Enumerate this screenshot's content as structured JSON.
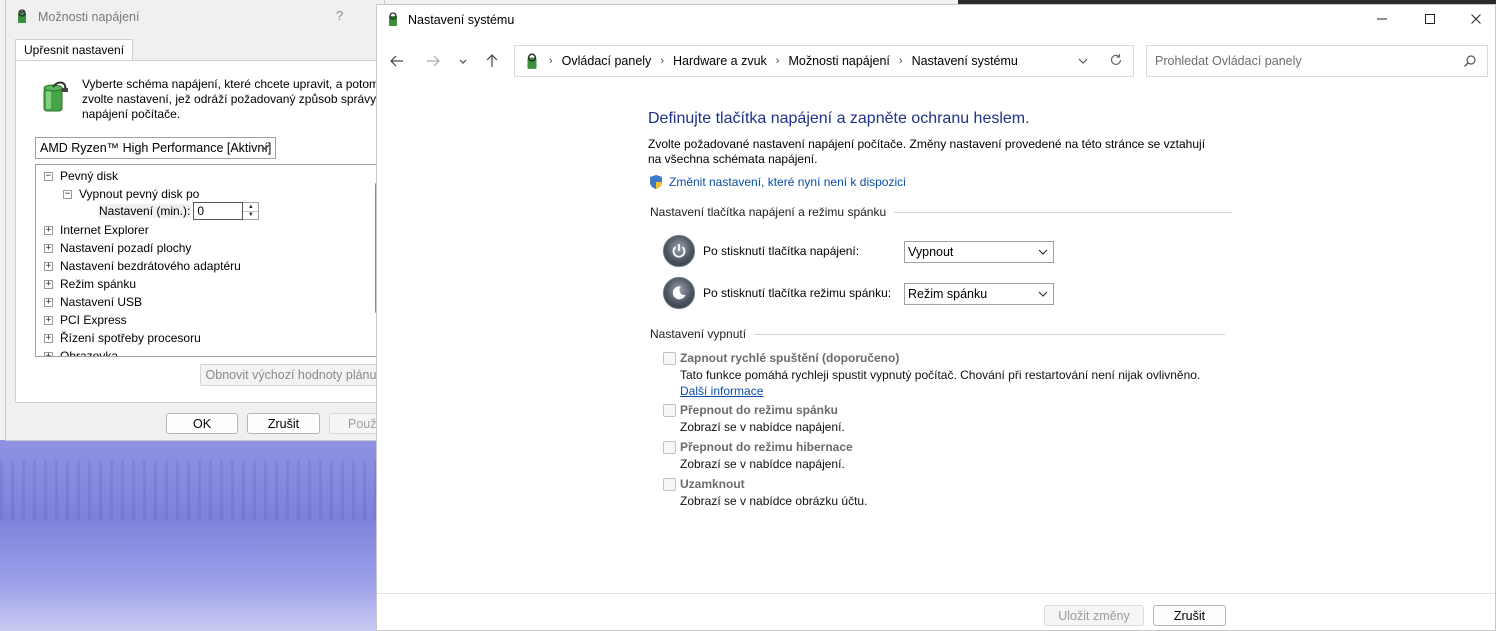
{
  "power_options_dialog": {
    "title": "Možnosti napájení",
    "help_glyph": "?",
    "tab_label": "Upřesnit nastavení",
    "description": "Vyberte schéma napájení, které chcete upravit, a potom zvolte nastavení, jež odráží požadovaný způsob správy napájení počítače.",
    "scheme_selected": "AMD Ryzen™ High Performance [Aktivní]",
    "tree": [
      {
        "label": "Pevný disk",
        "expander": "−",
        "level": 0
      },
      {
        "label": "Vypnout pevný disk po",
        "expander": "−",
        "level": 1
      },
      {
        "label": "Nastavení (min.):",
        "value": "0",
        "level": 2
      },
      {
        "label": "Internet Explorer",
        "expander": "+",
        "level": 0
      },
      {
        "label": "Nastavení pozadí plochy",
        "expander": "+",
        "level": 0
      },
      {
        "label": "Nastavení bezdrátového adaptéru",
        "expander": "+",
        "level": 0
      },
      {
        "label": "Režim spánku",
        "expander": "+",
        "level": 0
      },
      {
        "label": "Nastavení USB",
        "expander": "+",
        "level": 0
      },
      {
        "label": "PCI Express",
        "expander": "+",
        "level": 0
      },
      {
        "label": "Řízení spotřeby procesoru",
        "expander": "+",
        "level": 0
      },
      {
        "label": "Obrazovka",
        "expander": "+",
        "level": 0
      }
    ],
    "restore_button": "Obnovit výchozí hodnoty plánu",
    "ok_button": "OK",
    "cancel_button": "Zrušit",
    "apply_button": "Použít"
  },
  "system_settings_window": {
    "title": "Nastavení systému",
    "caption_minimize": "—",
    "caption_maximize": "☐",
    "caption_close": "✕",
    "breadcrumbs": [
      "Ovládací panely",
      "Hardware a zvuk",
      "Možnosti napájení",
      "Nastavení systému"
    ],
    "search_placeholder": "Prohledat Ovládací panely",
    "heading": "Definujte tlačítka napájení a zapněte ochranu heslem.",
    "intro": "Zvolte požadované nastavení napájení počítače. Změny nastavení provedené na této stránce se vztahují na všechna schémata napájení.",
    "change_link": "Změnit nastavení, které nyní není k dispozici",
    "group_buttons": "Nastavení tlačítka napájení a režimu spánku",
    "power_button_label": "Po stisknutí tlačítka napájení:",
    "power_button_value": "Vypnout",
    "sleep_button_label": "Po stisknutí tlačítka režimu spánku:",
    "sleep_button_value": "Režim spánku",
    "group_shutdown": "Nastavení vypnutí",
    "options": [
      {
        "label": "Zapnout rychlé spuštění (doporučeno)",
        "desc": "Tato funkce pomáhá rychleji spustit vypnutý počítač. Chování při restartování není nijak ovlivněno.",
        "more": "Další informace",
        "checked": false
      },
      {
        "label": "Přepnout do režimu spánku",
        "desc": "Zobrazí se v nabídce napájení.",
        "checked": false
      },
      {
        "label": "Přepnout do režimu hibernace",
        "desc": "Zobrazí se v nabídce napájení.",
        "checked": false
      },
      {
        "label": "Uzamknout",
        "desc": "Zobrazí se v nabídce obrázku účtu.",
        "checked": false
      }
    ],
    "save_button": "Uložit změny",
    "cancel_button": "Zrušit"
  },
  "colors": {
    "heading_blue": "#1e3287",
    "link_blue": "#0a4ea6",
    "wallpaper": "#8b8fe0"
  }
}
